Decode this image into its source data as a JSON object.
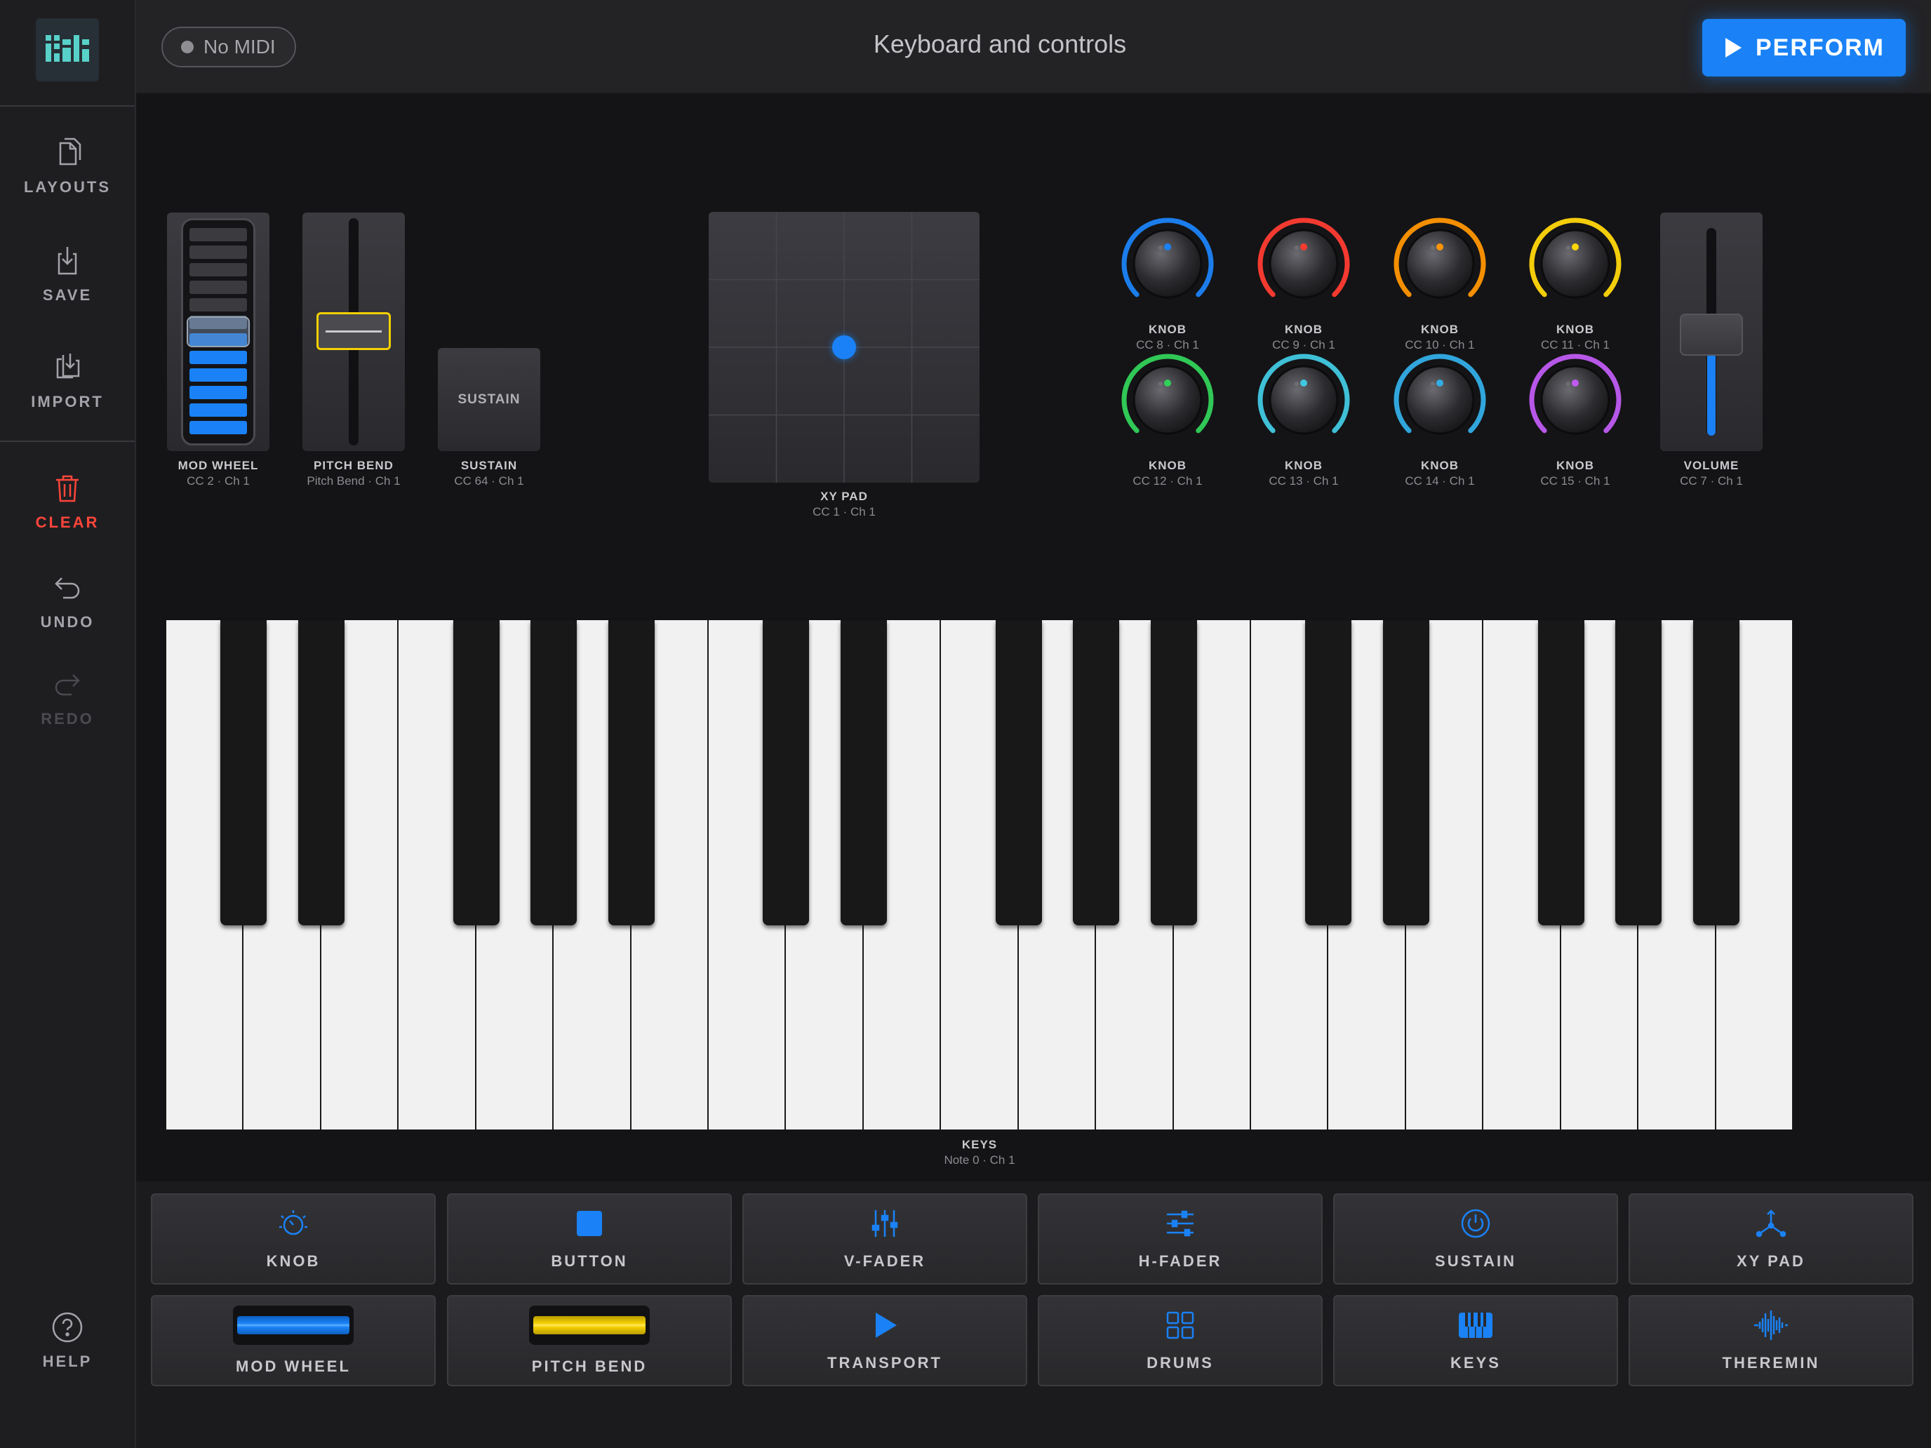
{
  "sidebar": {
    "items": [
      {
        "label": "LAYOUTS",
        "icon": "documents-icon"
      },
      {
        "label": "SAVE",
        "icon": "save-icon"
      },
      {
        "label": "IMPORT",
        "icon": "import-icon"
      },
      {
        "label": "CLEAR",
        "icon": "trash-icon"
      },
      {
        "label": "UNDO",
        "icon": "undo-icon"
      },
      {
        "label": "REDO",
        "icon": "redo-icon"
      }
    ],
    "help": "HELP"
  },
  "header": {
    "midi_status": "No MIDI",
    "title": "Keyboard and controls",
    "perform_label": "PERFORM"
  },
  "controls": {
    "mod_wheel": {
      "label": "MOD WHEEL",
      "sub": "CC 2 · Ch 1"
    },
    "pitch_bend": {
      "label": "PITCH BEND",
      "sub": "Pitch Bend · Ch 1"
    },
    "sustain": {
      "label": "SUSTAIN",
      "sub": "CC 64 · Ch 1",
      "button_text": "SUSTAIN"
    },
    "xy_pad": {
      "label": "XY PAD",
      "sub": "CC 1 · Ch 1"
    },
    "knobs": [
      {
        "label": "KNOB",
        "sub": "CC 8 · Ch 1",
        "color": "#1a82f6"
      },
      {
        "label": "KNOB",
        "sub": "CC 9 · Ch 1",
        "color": "#ff3b30"
      },
      {
        "label": "KNOB",
        "sub": "CC 10 · Ch 1",
        "color": "#ff9500"
      },
      {
        "label": "KNOB",
        "sub": "CC 11 · Ch 1",
        "color": "#ffd60a"
      },
      {
        "label": "KNOB",
        "sub": "CC 12 · Ch 1",
        "color": "#30d158"
      },
      {
        "label": "KNOB",
        "sub": "CC 13 · Ch 1",
        "color": "#40c8e0"
      },
      {
        "label": "KNOB",
        "sub": "CC 14 · Ch 1",
        "color": "#32ade6"
      },
      {
        "label": "KNOB",
        "sub": "CC 15 · Ch 1",
        "color": "#bf5af2"
      }
    ],
    "volume": {
      "label": "VOLUME",
      "sub": "CC 7 · Ch 1"
    },
    "keys": {
      "label": "KEYS",
      "sub": "Note 0 · Ch 1"
    }
  },
  "palette": {
    "row1": [
      {
        "label": "KNOB",
        "icon": "knob-icon"
      },
      {
        "label": "BUTTON",
        "icon": "button-icon"
      },
      {
        "label": "V-FADER",
        "icon": "v-fader-icon"
      },
      {
        "label": "H-FADER",
        "icon": "h-fader-icon"
      },
      {
        "label": "SUSTAIN",
        "icon": "sustain-icon"
      },
      {
        "label": "XY PAD",
        "icon": "xy-pad-icon"
      }
    ],
    "row2": [
      {
        "label": "MOD WHEEL",
        "icon": "mod-wheel-icon"
      },
      {
        "label": "PITCH BEND",
        "icon": "pitch-bend-icon"
      },
      {
        "label": "TRANSPORT",
        "icon": "play-icon"
      },
      {
        "label": "DRUMS",
        "icon": "drums-grid-icon"
      },
      {
        "label": "KEYS",
        "icon": "piano-keys-icon"
      },
      {
        "label": "THEREMIN",
        "icon": "waveform-icon"
      }
    ]
  },
  "colors": {
    "accent": "#1a82f6",
    "danger": "#ff453a",
    "pitch_bend": "#f5d000"
  }
}
